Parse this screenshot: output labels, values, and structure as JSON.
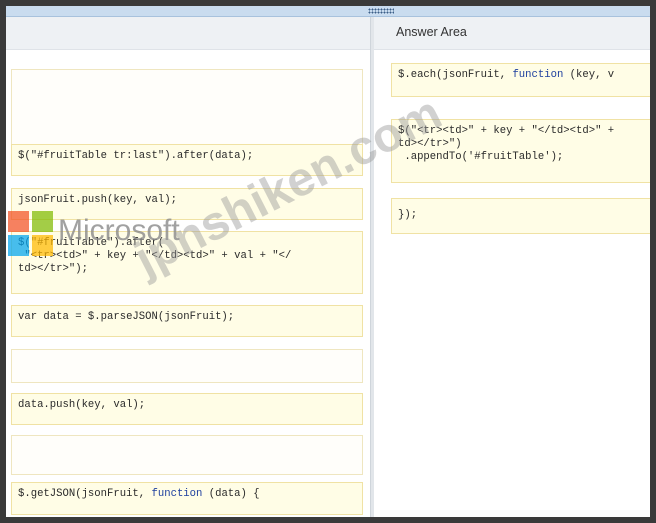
{
  "answer_area": {
    "title": "Answer Area"
  },
  "code_options": [
    {
      "prefix": "$(\"#fruitTable tr:last\").after(data);",
      "keyword": "",
      "suffix": ""
    },
    {
      "prefix": "jsonFruit.push(key, val);",
      "keyword": "",
      "suffix": ""
    },
    {
      "prefix": "$(\"#fruitTable\").after(\n \"<tr><td>\" + key + \"</td><td>\" + val + \"</\ntd></tr>\");",
      "keyword": "",
      "suffix": ""
    },
    {
      "prefix": "var data = $.parseJSON(jsonFruit);",
      "keyword": "",
      "suffix": ""
    },
    {
      "prefix": "data.push(key, val);",
      "keyword": "",
      "suffix": ""
    },
    {
      "prefix": "$.getJSON(jsonFruit, ",
      "keyword": "function",
      "suffix": " (data) {"
    }
  ],
  "answer_slots": [
    {
      "prefix": "$.each(jsonFruit, ",
      "keyword": "function",
      "suffix": " (key, v"
    },
    {
      "prefix": "$(\"<tr><td>\" + key + \"</td><td>\" +\ntd></tr>\")\n .appendTo('#fruitTable');",
      "keyword": "",
      "suffix": ""
    },
    {
      "prefix": "});",
      "keyword": "",
      "suffix": ""
    }
  ],
  "logo": {
    "text": "Microsoft"
  },
  "watermark": {
    "text": "jpnshiken.com"
  }
}
